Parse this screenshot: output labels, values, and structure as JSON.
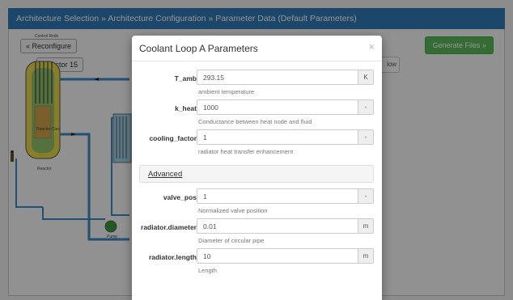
{
  "breadcrumb": "Architecture Selection » Architecture Configuration » Parameter Data (Default Parameters)",
  "background": {
    "reconfigure_label": "« Reconfigure",
    "reactor_label": "Reactor 15",
    "generate_label": "Generate Files »",
    "flow_tab_label": "low",
    "pump_label": "Pump",
    "reactor_caption": "Reactor",
    "control_rods_label": "Control Rods",
    "core_label": "Reactor Core"
  },
  "modal": {
    "title": "Coolant Loop A Parameters",
    "close": "×",
    "fields": [
      {
        "label": "T_amb",
        "value": "293.15",
        "unit": "K",
        "help": "ambient temperature"
      },
      {
        "label": "k_heat",
        "value": "1000",
        "unit": "-",
        "help": "Conductance between heat node and fluid"
      },
      {
        "label": "cooling_factor",
        "value": "1",
        "unit": "-",
        "help": "radiator heat transfer enhancement"
      }
    ],
    "advanced_label": "Advanced",
    "advanced_fields": [
      {
        "label": "valve_pos",
        "value": "1",
        "unit": "-",
        "help": "Normalized valve position"
      },
      {
        "label": "radiator.diameter",
        "value": "0.01",
        "unit": "m",
        "help": "Diameter of circular pipe"
      },
      {
        "label": "radiator.length",
        "value": "10",
        "unit": "m",
        "help": "Length"
      }
    ]
  },
  "colors": {
    "breadcrumb_bg": "#337ab7",
    "generate_bg": "#5cb85c",
    "pipe_blue": "#3b8bc8",
    "vessel_yellow": "#e8d84a",
    "vessel_green": "#8fc46a"
  }
}
